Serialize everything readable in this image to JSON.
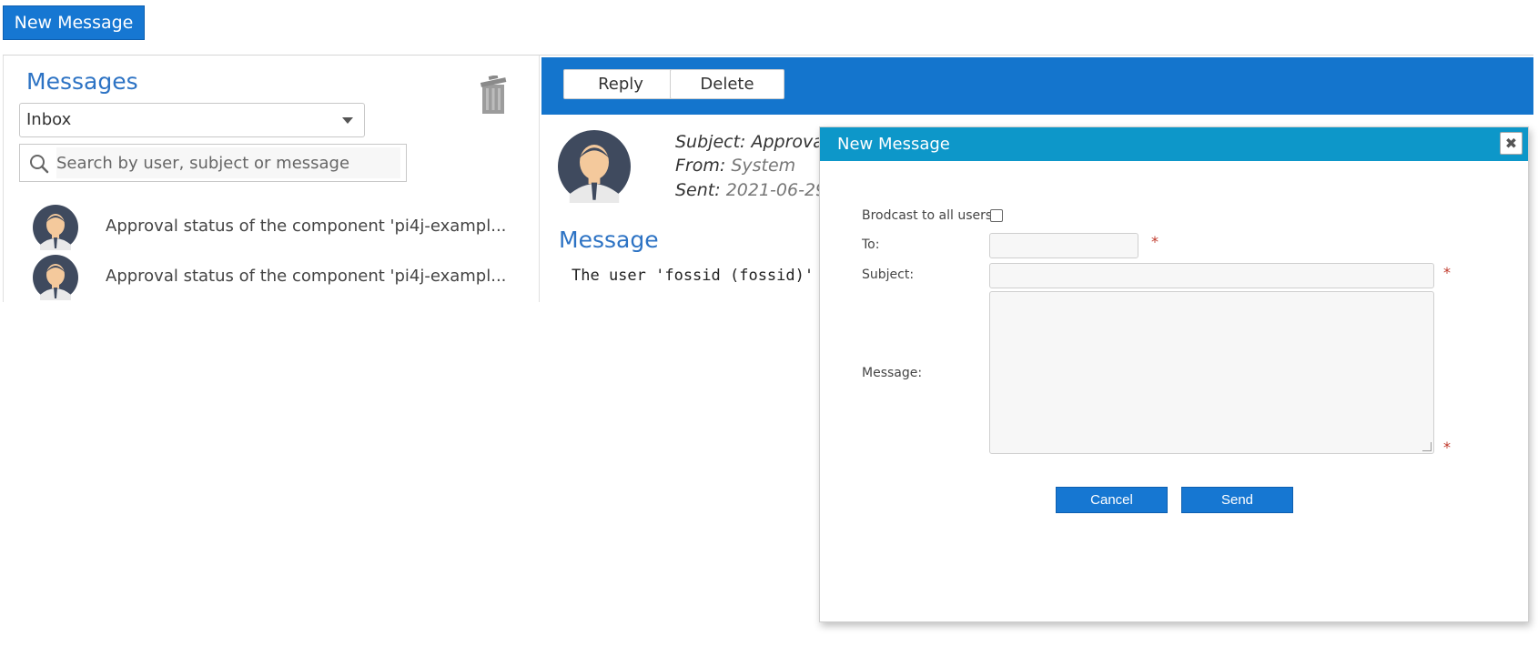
{
  "top": {
    "new_message_label": "New Message"
  },
  "left": {
    "title": "Messages",
    "folder": "Inbox",
    "search_placeholder": "Search by user, subject or message",
    "items": [
      {
        "text": "Approval status of the component 'pi4j-exampl..."
      },
      {
        "text": "Approval status of the component 'pi4j-exampl..."
      }
    ]
  },
  "right": {
    "reply_label": "Reply",
    "delete_label": "Delete",
    "subject_label": "Subject:",
    "subject_value": "Approval",
    "from_label": "From:",
    "from_value": "System",
    "sent_label": "Sent:",
    "sent_value": "2021-06-29",
    "message_title": "Message",
    "message_body": "The user 'fossid (fossid)'"
  },
  "dialog": {
    "title": "New Message",
    "close_glyph": "✖",
    "broadcast_label": "Brodcast to all users:",
    "to_label": "To:",
    "subject_label": "Subject:",
    "message_label": "Message:",
    "required_mark": "*",
    "cancel_label": "Cancel",
    "send_label": "Send"
  }
}
